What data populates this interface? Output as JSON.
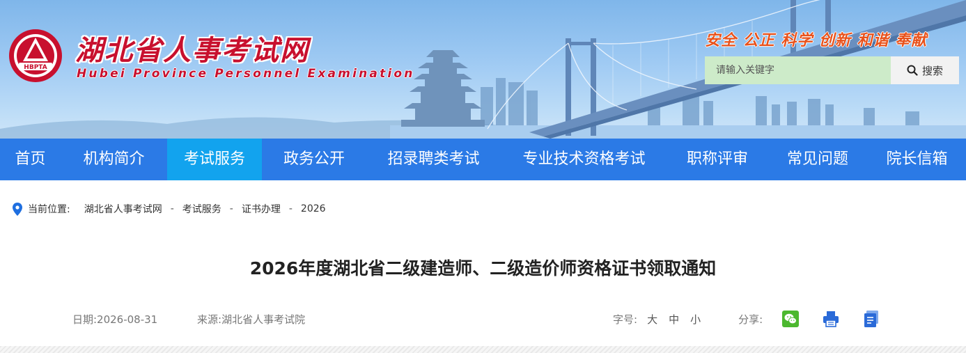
{
  "header": {
    "site_name": "湖北省人事考试网",
    "site_name_en": "Hubei Province Personnel Examination",
    "logo_text": "HBPTA",
    "slogan": "安全 公正 科学 创新 和谐 奉献",
    "brand_color": "#c8102e"
  },
  "search": {
    "placeholder": "请输入关键字",
    "button_label": "搜索",
    "icon": "search-icon"
  },
  "nav": {
    "items": [
      {
        "label": "首页"
      },
      {
        "label": "机构简介"
      },
      {
        "label": "考试服务"
      },
      {
        "label": "政务公开"
      },
      {
        "label": "招录聘类考试"
      },
      {
        "label": "专业技术资格考试"
      },
      {
        "label": "职称评审"
      },
      {
        "label": "常见问题"
      },
      {
        "label": "院长信箱"
      }
    ],
    "active": "考试服务",
    "bg_color": "#2b7ae6",
    "active_color": "#12a3ee"
  },
  "breadcrumb": {
    "label": "当前位置:",
    "icon": "location-pin-icon",
    "items": [
      "湖北省人事考试网",
      "考试服务",
      "证书办理",
      "2026"
    ],
    "separator": "-"
  },
  "article": {
    "title": "2026年度湖北省二级建造师、二级造价师资格证书领取通知",
    "date": "日期:2026-08-31",
    "source": "来源:湖北省人事考试院",
    "font_size_label": "字号:",
    "font_sizes": [
      "大",
      "中",
      "小"
    ],
    "share_label": "分享:",
    "share_icons": [
      "wechat-icon",
      "print-icon",
      "document-icon"
    ]
  }
}
